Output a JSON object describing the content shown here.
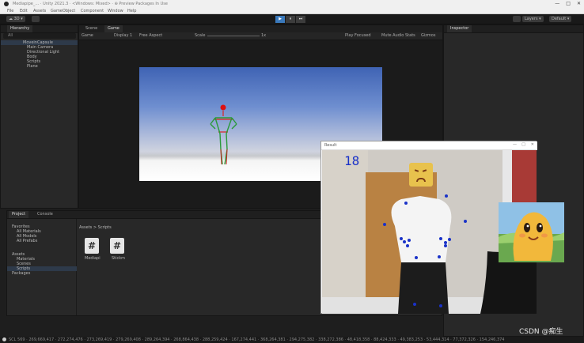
{
  "window": {
    "title": "Mediapipe_… · Unity 2021.3 · <Windows: Mixed> ·  ⊕  Preview Packages In Use",
    "controls": [
      "—",
      "□",
      "✕"
    ]
  },
  "menu": {
    "items": [
      "File",
      "Edit",
      "Assets",
      "GameObject",
      "Component",
      "Window",
      "Help"
    ]
  },
  "toolbar": {
    "left_button": "☁ 3D ▾",
    "play": "▶",
    "pause": "⏸",
    "step": "⏭",
    "layers": "Layers ▾",
    "layout": "Default ▾"
  },
  "hierarchy": {
    "tab": "Hierarchy",
    "search_placeholder": "All",
    "items": [
      "MoveinCapsule",
      "Main Camera",
      "Directional Light",
      "Body",
      "Scripts",
      "Plane"
    ]
  },
  "scene_tabs": [
    "Scene",
    "Game"
  ],
  "game_bar": {
    "mode": "Game",
    "display": "Display 1",
    "aspect": "Free Aspect",
    "scale": "Scale",
    "scale_value": "1x",
    "play_focused": "Play Focused",
    "mute": "Mute Audio",
    "stats": "Stats",
    "gizmos": "Gizmos"
  },
  "inspector": {
    "tab": "Inspector"
  },
  "project": {
    "tabs": [
      "Project",
      "Console"
    ],
    "tree": [
      "Favorites",
      "All Materials",
      "All Models",
      "All Prefabs",
      "Assets",
      "Materials",
      "Scenes",
      "Scripts",
      "Packages"
    ],
    "breadcrumb": "Assets > Scripts",
    "files": [
      {
        "name": "Mediapi"
      },
      {
        "name": "Stickm"
      }
    ]
  },
  "webcam": {
    "title": "Result",
    "counter": "18",
    "win_controls": [
      "—",
      "□",
      "✕"
    ]
  },
  "status_bar": {
    "text": "SCL 569 · 269,669,417 · 272,274,476 · 273,269,419 · 279,269,408 · 289,264,394 · 268,864,438 · 288,259,424 · 167,274,441 · 368,264,381 · 294,275,382 · 338,272,386 · 48,418,358 · 88,424,333 · 49,383,253 · 53,444,314 · 77,372,326 · 154,246,374"
  },
  "watermark": "CSDN @痴生",
  "colors": {
    "accent": "#3a79bb",
    "editor_bg": "#282828",
    "landmark": "#1a32c8"
  }
}
